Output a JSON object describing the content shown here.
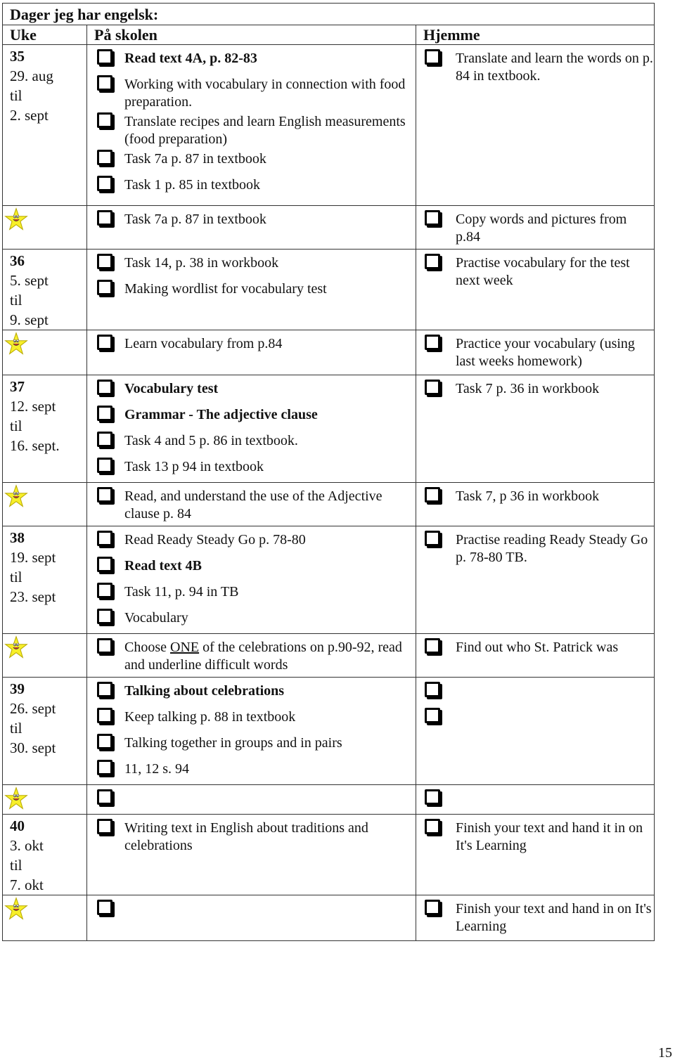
{
  "title": "Dager jeg har engelsk:",
  "headers": {
    "week": "Uke",
    "school": "På skolen",
    "home": "Hjemme"
  },
  "icons": {
    "checkbox": "checkbox-icon",
    "star": "smiley-star-icon"
  },
  "colors": {
    "star_fill": "#f7ef2a",
    "star_stroke": "#b7a800",
    "border": "#333333"
  },
  "rows": [
    {
      "type": "week",
      "week": {
        "num": "35",
        "from": "29. aug",
        "til": "til",
        "to": "2. sept"
      },
      "school": [
        {
          "text": "Read text 4A, p. 82-83",
          "bold": true
        },
        {
          "text": "Working with vocabulary in connection with food preparation.",
          "bold": false
        },
        {
          "text": "Translate recipes and learn English measurements (food preparation)",
          "bold": false
        },
        {
          "text": "Task 7a p. 87 in textbook",
          "bold": false
        },
        {
          "text": "Task 1 p. 85 in textbook",
          "bold": false
        }
      ],
      "home": [
        {
          "text": "Translate and learn the words on p. 84 in textbook."
        }
      ]
    },
    {
      "type": "star",
      "school": [
        {
          "text": "Task 7a p. 87 in textbook",
          "bold": false
        }
      ],
      "home": [
        {
          "text": "Copy words and pictures from p.84"
        }
      ]
    },
    {
      "type": "week",
      "week": {
        "num": "36",
        "from": "5. sept",
        "til": "til",
        "to": "9. sept"
      },
      "school": [
        {
          "text": "Task 14, p. 38 in workbook",
          "bold": false
        },
        {
          "text": "Making wordlist for vocabulary test",
          "bold": false
        }
      ],
      "home": [
        {
          "text": "Practise vocabulary for the test next week"
        }
      ]
    },
    {
      "type": "star",
      "school": [
        {
          "text": "Learn vocabulary from p.84",
          "bold": false
        }
      ],
      "home": [
        {
          "text": "Practice your vocabulary (using last weeks homework)"
        }
      ]
    },
    {
      "type": "week",
      "week": {
        "num": "37",
        "from": "12. sept",
        "til": "til",
        "to": "16. sept."
      },
      "school": [
        {
          "text": "Vocabulary test",
          "bold": true
        },
        {
          "text": "Grammar - The adjective clause",
          "bold": true
        },
        {
          "text": "Task 4 and 5 p. 86 in textbook.",
          "bold": false
        },
        {
          "text": "Task 13 p 94 in textbook",
          "bold": false
        }
      ],
      "home": [
        {
          "text": "Task 7 p. 36 in workbook"
        }
      ]
    },
    {
      "type": "star",
      "school": [
        {
          "text": "Read, and understand the use of the Adjective clause p. 84",
          "bold": false
        }
      ],
      "home": [
        {
          "text": "Task 7, p 36 in workbook"
        }
      ]
    },
    {
      "type": "week",
      "week": {
        "num": "38",
        "from": "19. sept",
        "til": "til",
        "to": "23. sept"
      },
      "school": [
        {
          "text": "Read Ready Steady Go p. 78-80",
          "bold": false
        },
        {
          "text": "Read text 4B",
          "bold": true
        },
        {
          "text": "Task 11, p. 94 in TB",
          "bold": false
        },
        {
          "text": "Vocabulary",
          "bold": false
        }
      ],
      "home": [
        {
          "text": "Practise reading Ready Steady Go p. 78-80 TB."
        }
      ]
    },
    {
      "type": "star",
      "school": [
        {
          "pre": "Choose ",
          "underlined": "ONE",
          "post": " of the celebrations on p.90-92, read and underline difficult words",
          "bold": false
        }
      ],
      "home": [
        {
          "text": "Find out who St. Patrick was"
        }
      ]
    },
    {
      "type": "week",
      "week": {
        "num": "39",
        "from": "26. sept",
        "til": "til",
        "to": "30. sept"
      },
      "school": [
        {
          "text": "Talking about celebrations",
          "bold": true
        },
        {
          "text": "Keep talking p. 88 in textbook",
          "bold": false
        },
        {
          "text": "Talking together in groups and in pairs",
          "bold": false
        },
        {
          "text": "11, 12 s. 94",
          "bold": false
        }
      ],
      "home": [
        {
          "text": ""
        },
        {
          "text": ""
        }
      ]
    },
    {
      "type": "star",
      "school": [
        {
          "text": "",
          "bold": false
        }
      ],
      "home": [
        {
          "text": ""
        }
      ]
    },
    {
      "type": "week",
      "week": {
        "num": "40",
        "from": "3. okt",
        "til": "til",
        "to": "7. okt"
      },
      "school": [
        {
          "text": "Writing text in English about traditions and celebrations",
          "bold": false
        }
      ],
      "home": [
        {
          "text": "Finish your text and hand it in on It's Learning"
        }
      ]
    },
    {
      "type": "star",
      "school": [
        {
          "text": "",
          "bold": false
        }
      ],
      "home": [
        {
          "text": "Finish your text and hand in on It's Learning"
        }
      ]
    }
  ],
  "page_number": "15"
}
